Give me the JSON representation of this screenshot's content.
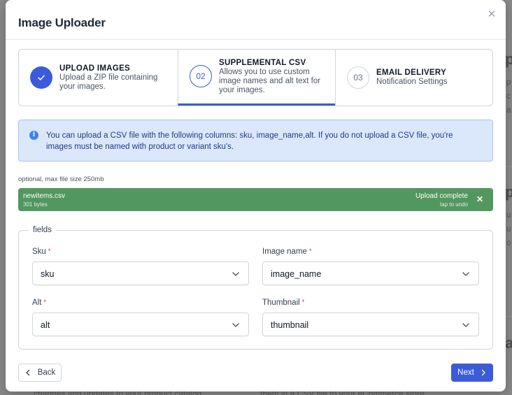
{
  "modal": {
    "title": "Image Uploader",
    "close_icon": "close-icon"
  },
  "steps": [
    {
      "number": "",
      "icon": "check-icon",
      "title": "UPLOAD IMAGES",
      "description": "Upload a ZIP file containing your images.",
      "state": "complete"
    },
    {
      "number": "02",
      "title": "SUPPLEMENTAL CSV",
      "description": "Allows you to use custom image names and alt text for your images.",
      "state": "current"
    },
    {
      "number": "03",
      "title": "EMAIL DELIVERY",
      "description": "Notification Settings",
      "state": "upcoming"
    }
  ],
  "info": {
    "icon": "info-icon",
    "text": "You can upload a CSV file with the following columns: sku, image_name,alt. If you do not upload a CSV file, you're images must be named with product or variant sku's."
  },
  "upload": {
    "hint": "optional, max file size 250mb",
    "file_name": "newitems.csv",
    "file_size": "301 bytes",
    "status": "Upload complete",
    "undo_hint": "tap to undo",
    "remove_icon": "close-icon"
  },
  "fields": {
    "legend": "fields",
    "required_marker": "*",
    "sku": {
      "label": "Sku",
      "value": "sku"
    },
    "image_name": {
      "label": "Image name",
      "value": "image_name"
    },
    "alt": {
      "label": "Alt",
      "value": "alt"
    },
    "thumbnail": {
      "label": "Thumbnail",
      "value": "thumbnail"
    }
  },
  "footer": {
    "back_label": "Back",
    "next_label": "Next"
  },
  "colors": {
    "accent": "#3b5bdb",
    "success": "#529760",
    "info_bg": "#dbe8fb",
    "required": "#dc2626"
  },
  "background_fragments": {
    "bottom_left": "changes and updates to your product catalog",
    "bottom_right": "them in a CSV file to your eCommerce store"
  }
}
